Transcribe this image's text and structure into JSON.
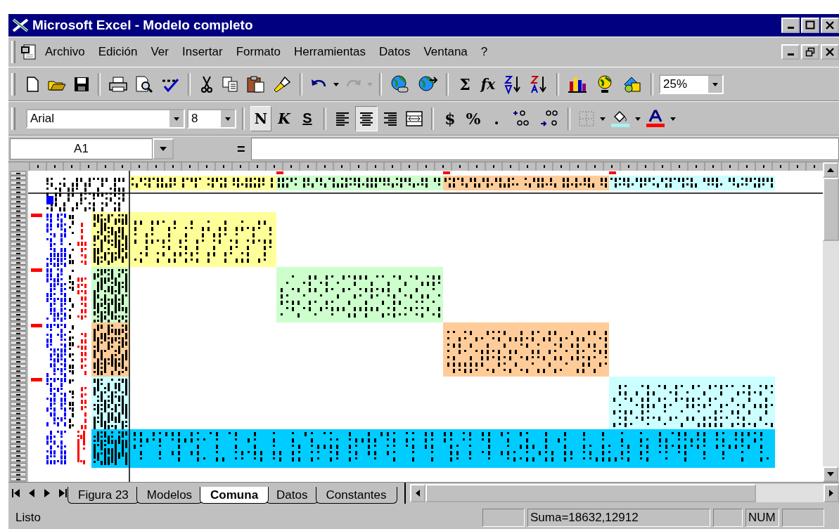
{
  "window": {
    "title": "Microsoft Excel - Modelo completo"
  },
  "menu": [
    {
      "label": "Archivo"
    },
    {
      "label": "Edición"
    },
    {
      "label": "Ver"
    },
    {
      "label": "Insertar"
    },
    {
      "label": "Formato"
    },
    {
      "label": "Herramientas"
    },
    {
      "label": "Datos"
    },
    {
      "label": "Ventana"
    },
    {
      "label": "?"
    }
  ],
  "standard_toolbar": {
    "redo_disabled": true,
    "sum": "Σ",
    "function": "fx",
    "zoom": "25%"
  },
  "format_toolbar": {
    "font": "Arial",
    "size": "8",
    "bold": "N",
    "italic": "K",
    "underline": "S",
    "align_center_pressed": true,
    "currency": "$",
    "percent": "%",
    "thousands": "."
  },
  "formula_bar": {
    "name_box": "A1",
    "equals": "="
  },
  "sheet_tabs": [
    {
      "label": "Figura 23",
      "selected": false
    },
    {
      "label": "Modelos",
      "selected": false
    },
    {
      "label": "Comuna",
      "selected": true
    },
    {
      "label": "Datos",
      "selected": false
    },
    {
      "label": "Constantes",
      "selected": false
    }
  ],
  "status_bar": {
    "mode": "Listo",
    "sum": "Suma=18632,12912",
    "num": "NUM"
  }
}
